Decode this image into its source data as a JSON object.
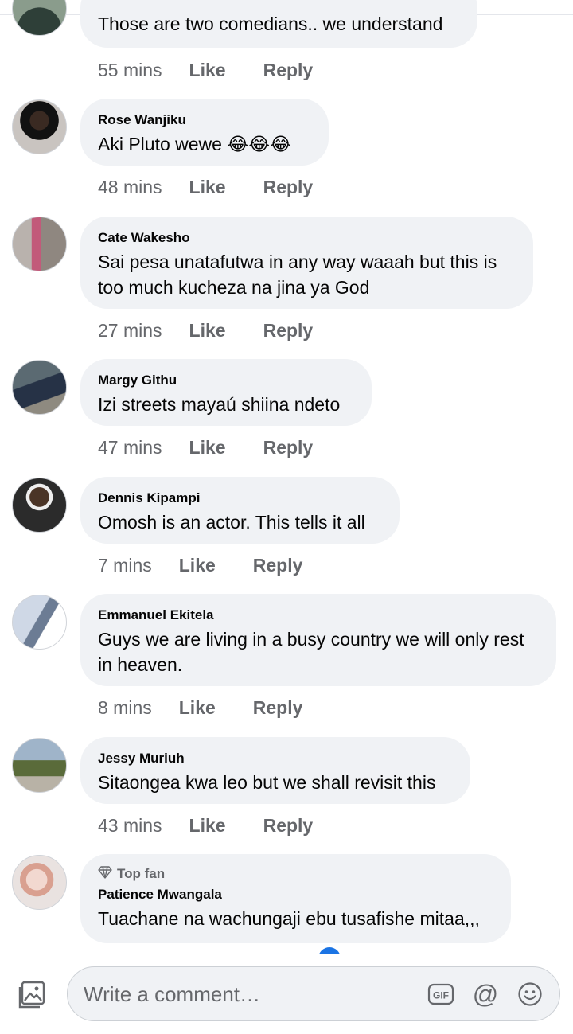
{
  "comments": [
    {
      "name": "",
      "text": "Those are two comedians.. we understand",
      "time": "55 mins",
      "like": "Like",
      "reply": "Reply"
    },
    {
      "name": "Rose Wanjiku",
      "text": "Aki Pluto wewe 😂😂😂",
      "time": "48 mins",
      "like": "Like",
      "reply": "Reply"
    },
    {
      "name": "Cate Wakesho",
      "text": "Sai pesa unatafutwa  in any way waaah but this is too much kucheza na jina ya God",
      "time": "27 mins",
      "like": "Like",
      "reply": "Reply"
    },
    {
      "name": "Margy Githu",
      "text": "Izi streets mayaú shiina ndeto",
      "time": "47 mins",
      "like": "Like",
      "reply": "Reply"
    },
    {
      "name": "Dennis Kipampi",
      "text": "Omosh is an actor. This tells it all",
      "time": "7 mins",
      "like": "Like",
      "reply": "Reply"
    },
    {
      "name": "Emmanuel Ekitela",
      "text": "Guys we are living in a busy country we will only rest in heaven.",
      "time": "8 mins",
      "like": "Like",
      "reply": "Reply"
    },
    {
      "name": "Jessy Muriuh",
      "text": "Sitaongea kwa leo but we shall revisit this",
      "time": "43 mins",
      "like": "Like",
      "reply": "Reply"
    },
    {
      "name": "Patience Mwangala",
      "badge": "Top fan",
      "text": "Tuachane na wachungaji ebu tusafishe mitaa,,,",
      "time": "",
      "like": "",
      "reply": ""
    }
  ],
  "composer": {
    "placeholder": "Write a comment…",
    "gif_label": "GIF",
    "mention_label": "@"
  },
  "icons": {
    "photo": "photo-icon",
    "gif": "gif-icon",
    "mention": "mention-icon",
    "emoji": "emoji-icon",
    "top_fan": "diamond-icon"
  },
  "colors": {
    "bubble": "#f0f2f5",
    "meta_text": "#65676b",
    "accent": "#1b74e4"
  }
}
